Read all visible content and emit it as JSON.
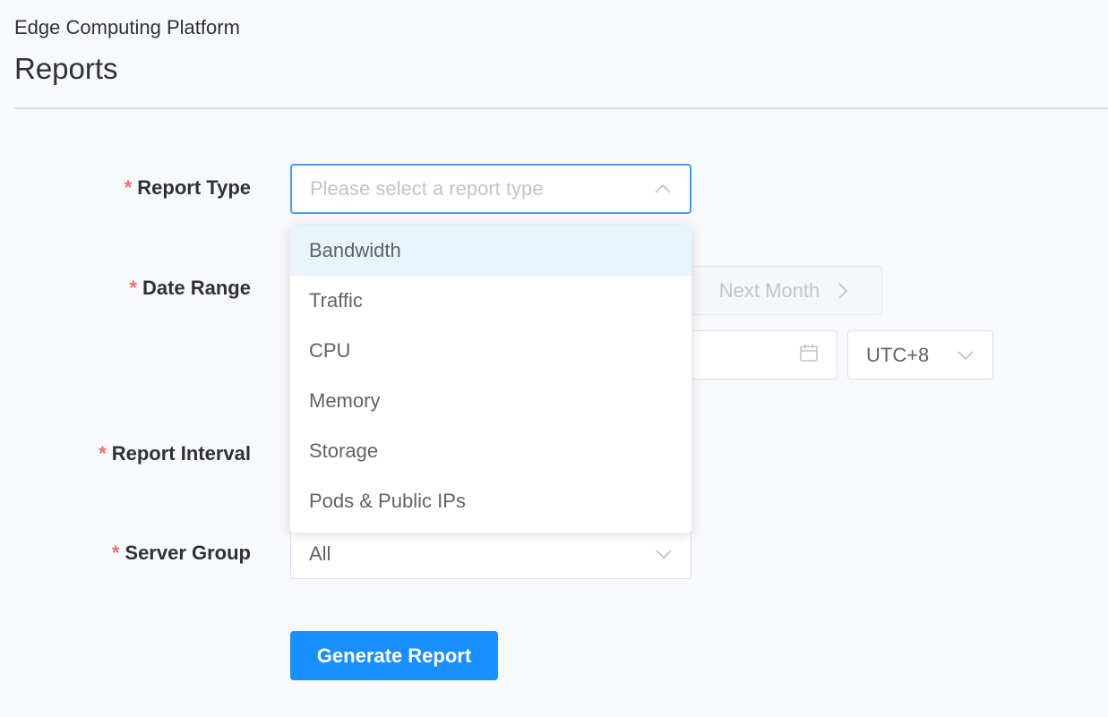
{
  "header": {
    "breadcrumb": "Edge Computing Platform",
    "title": "Reports"
  },
  "form": {
    "required_mark": "*",
    "report_type": {
      "label": "Report Type",
      "placeholder": "Please select a report type",
      "options": [
        "Bandwidth",
        "Traffic",
        "CPU",
        "Memory",
        "Storage",
        "Pods & Public IPs"
      ],
      "hovered_option": "Bandwidth"
    },
    "date_range": {
      "label": "Date Range",
      "next_button": "Next Month",
      "timezone": "UTC+8"
    },
    "report_interval": {
      "label": "Report Interval"
    },
    "server_group": {
      "label": "Server Group",
      "value": "All"
    },
    "submit_label": "Generate Report"
  },
  "colors": {
    "accent": "#409eff",
    "primary_button": "#1890ff",
    "required": "#f56c6c",
    "hover_row": "#e8f4fc"
  },
  "icons": [
    "chevron-up-icon",
    "chevron-right-icon",
    "calendar-icon",
    "chevron-down-icon"
  ]
}
